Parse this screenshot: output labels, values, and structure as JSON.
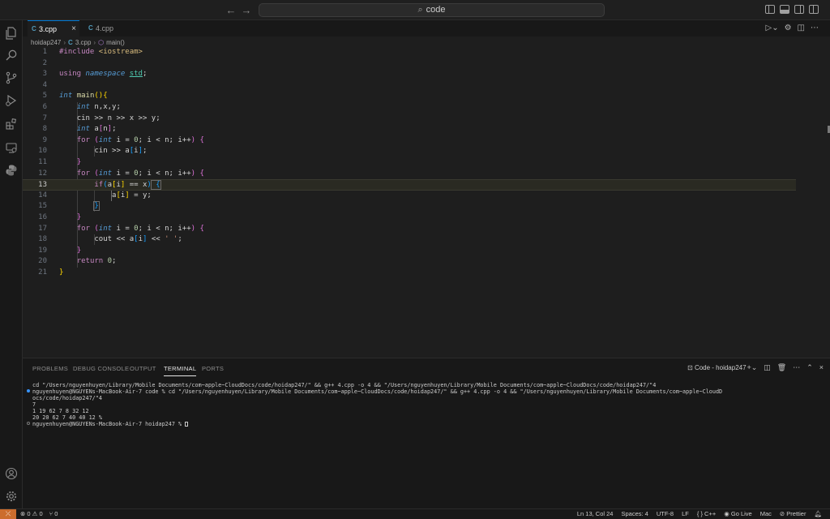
{
  "titlebar": {
    "search_text": "code",
    "back_icon": "arrow-left-icon",
    "forward_icon": "arrow-right-icon"
  },
  "tabs": [
    {
      "label": "3.cpp",
      "active": true
    },
    {
      "label": "4.cpp",
      "active": false
    }
  ],
  "tab_close": "×",
  "breadcrumb": {
    "folder": "hoidap247",
    "sep": "›",
    "file": "3.cpp",
    "symbol": "main()"
  },
  "editor": {
    "current_line": 13,
    "lines": [
      {
        "n": "1"
      },
      {
        "n": "2"
      },
      {
        "n": "3"
      },
      {
        "n": "4"
      },
      {
        "n": "5"
      },
      {
        "n": "6"
      },
      {
        "n": "7"
      },
      {
        "n": "8"
      },
      {
        "n": "9"
      },
      {
        "n": "10"
      },
      {
        "n": "11"
      },
      {
        "n": "12"
      },
      {
        "n": "13"
      },
      {
        "n": "14"
      },
      {
        "n": "15"
      },
      {
        "n": "16"
      },
      {
        "n": "17"
      },
      {
        "n": "18"
      },
      {
        "n": "19"
      },
      {
        "n": "20"
      },
      {
        "n": "21"
      }
    ],
    "code": {
      "l1_a": "#include ",
      "l1_b": "<iostream>",
      "l3_a": "using ",
      "l3_b": "namespace ",
      "l3_c": "std",
      "l3_d": ";",
      "l5_a": "int ",
      "l5_b": "main",
      "l5_c": "()",
      "l5_d": "{",
      "l6_a": "int ",
      "l6_b": "n,x,y;",
      "l7": "cin >> n >> x >> y;",
      "l8_a": "int ",
      "l8_b": "a",
      "l8_c": "[",
      "l8_d": "n",
      "l8_e": "]",
      "l8_f": ";",
      "for_kw": "for ",
      "paren_o": "(",
      "paren_c": ")",
      "int_kw": "int ",
      "for_body_a": "i = ",
      "zero": "0",
      "for_body_b": "; i < n; i++",
      "brace_o": " {",
      "l10_a": "cin >> a",
      "br_o": "[",
      "br_i": "i",
      "br_c": "]",
      "semi": ";",
      "brace_c": "}",
      "l13_if": "if",
      "l13_a": "a",
      "l13_b": " == x",
      "l13_c": " {",
      "l14_a": "a",
      "l14_b": " = y;",
      "l18_a": "cout << a",
      "l18_b": " << ",
      "l18_c": "' '",
      "l20_a": "return ",
      "l20_b": "0",
      "l20_c": ";"
    }
  },
  "panel": {
    "tabs": [
      "PROBLEMS",
      "DEBUG CONSOLE",
      "OUTPUT",
      "TERMINAL",
      "PORTS"
    ],
    "active_tab": "TERMINAL",
    "terminal_name": "Code - hoidap247",
    "terminal_lines": [
      "cd \"/Users/nguyenhuyen/Library/Mobile Documents/com~apple~CloudDocs/code/hoidap247/\" && g++ 4.cpp -o 4 && \"/Users/nguyenhuyen/Library/Mobile Documents/com~apple~CloudDocs/code/hoidap247/\"4",
      "nguyenhuyen@NGUYENs-MacBook-Air-7 code % cd \"/Users/nguyenhuyen/Library/Mobile Documents/com~apple~CloudDocs/code/hoidap247/\" && g++ 4.cpp -o 4 && \"/Users/nguyenhuyen/Library/Mobile Documents/com~apple~CloudD",
      "ocs/code/hoidap247/\"4",
      "7",
      "1 19 62 7 8 32 12",
      "20 20 62 7 40 40 12 %",
      "nguyenhuyen@NGUYENs-MacBook-Air-7 hoidap247 % "
    ]
  },
  "statusbar": {
    "remote_icon": "remote-icon",
    "errors": "0",
    "warnings": "0",
    "ports": "0",
    "position": "Ln 13, Col 24",
    "spaces": "Spaces: 4",
    "encoding": "UTF-8",
    "eol": "LF",
    "language": "C++",
    "golive": "Go Live",
    "platform": "Mac",
    "prettier": "Prettier"
  },
  "colors": {
    "accent": "#0078d4",
    "remote_bg": "#cc6d2e",
    "keyword": "#569cd6",
    "control": "#c586c0",
    "number": "#b5cea8",
    "string": "#ce9178"
  }
}
